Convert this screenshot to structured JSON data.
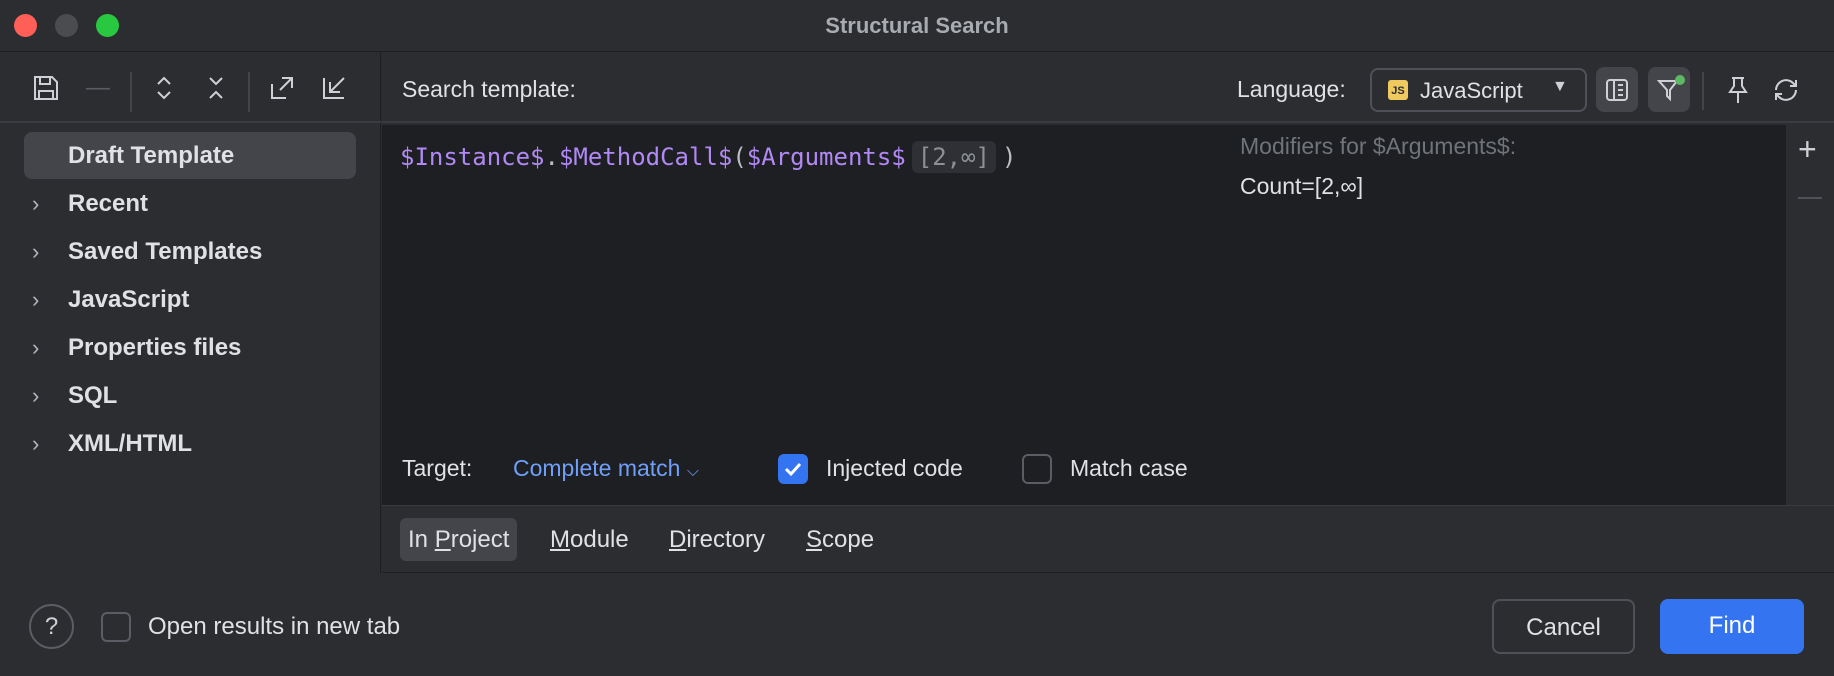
{
  "window": {
    "title": "Structural Search"
  },
  "toolbar_icons": [
    "save-icon",
    "remove-icon",
    "expand-all-icon",
    "collapse-all-icon",
    "export-icon",
    "import-icon"
  ],
  "tree": [
    {
      "label": "Draft Template",
      "selected": true
    },
    {
      "label": "Recent"
    },
    {
      "label": "Saved Templates"
    },
    {
      "label": "JavaScript"
    },
    {
      "label": "Properties files"
    },
    {
      "label": "SQL"
    },
    {
      "label": "XML/HTML"
    }
  ],
  "header": {
    "search_template_label": "Search template:",
    "language_label": "Language:",
    "language_value": "JavaScript",
    "language_badge": "JS"
  },
  "editor": {
    "part1": "$Instance$",
    "part2": ".",
    "part3": "$MethodCall$",
    "part4": "(",
    "part5": "$Arguments$",
    "count_badge": "[2,∞]",
    "part6": ")",
    "modifiers_title": "Modifiers for $Arguments$:",
    "modifiers_value": "Count=[2,∞]"
  },
  "options": {
    "target_label": "Target:",
    "target_value": "Complete match",
    "injected_code_label": "Injected code",
    "injected_code_checked": true,
    "match_case_label": "Match case",
    "match_case_checked": false
  },
  "scope": {
    "tabs": [
      {
        "pre": "In ",
        "u": "P",
        "post": "roject",
        "selected": true
      },
      {
        "pre": "",
        "u": "M",
        "post": "odule"
      },
      {
        "pre": "",
        "u": "D",
        "post": "irectory"
      },
      {
        "pre": "",
        "u": "S",
        "post": "cope"
      }
    ]
  },
  "footer": {
    "help": "?",
    "open_new_tab_label": "Open results in new tab",
    "cancel": "Cancel",
    "find": "Find"
  },
  "colors": {
    "accent": "#3574f0",
    "variable": "#b189f5",
    "link": "#6f9ff8"
  }
}
